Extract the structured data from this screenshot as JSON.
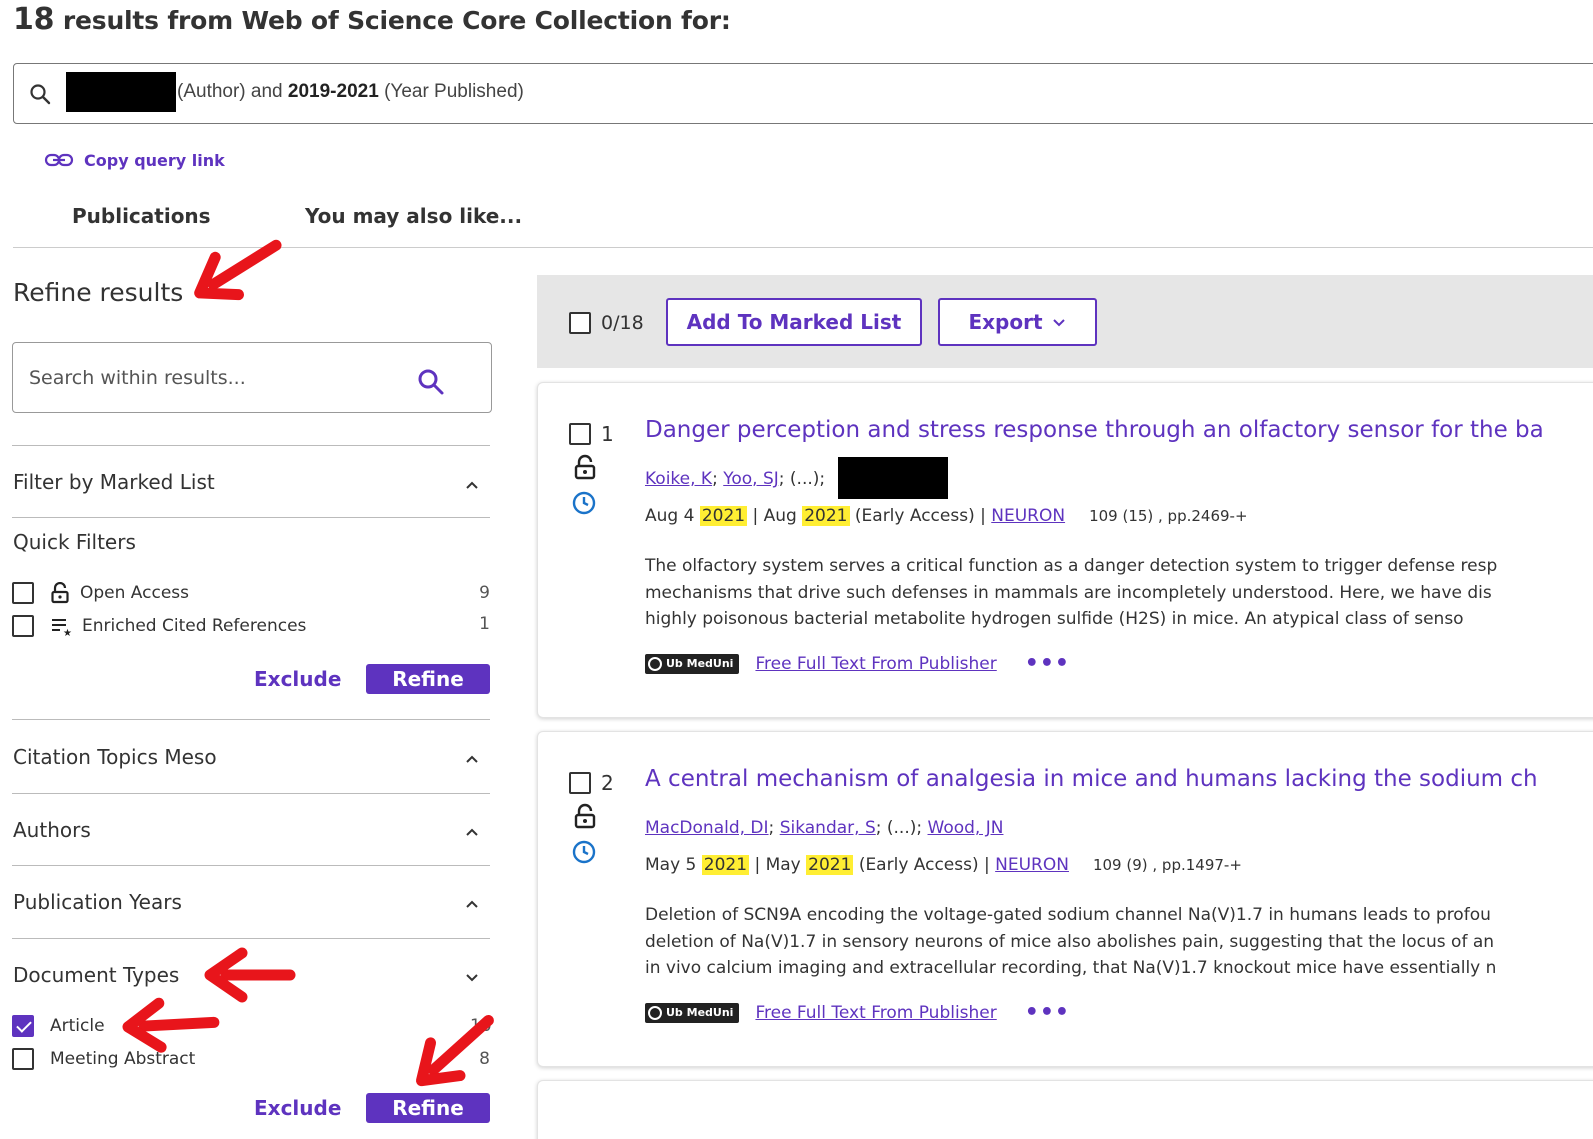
{
  "header": {
    "count": "18",
    "title": "results from Web of Science Core Collection for:",
    "query_field": "(Author) and",
    "query_years": "2019-2021",
    "query_year_field": "(Year Published)",
    "copy_link": "Copy query link"
  },
  "tabs": [
    "Publications",
    "You may also like..."
  ],
  "sidebar": {
    "title": "Refine results",
    "search_placeholder": "Search within results...",
    "sections": {
      "marked_list": "Filter by Marked List",
      "quick_filters": "Quick Filters",
      "citation_topics": "Citation Topics Meso",
      "authors": "Authors",
      "pub_years": "Publication Years",
      "doc_types": "Document Types"
    },
    "quick_filters": [
      {
        "label": "Open Access",
        "count": "9"
      },
      {
        "label": "Enriched Cited References",
        "count": "1"
      }
    ],
    "doc_types": [
      {
        "label": "Article",
        "count": "10",
        "checked": true
      },
      {
        "label": "Meeting Abstract",
        "count": "8",
        "checked": false
      }
    ],
    "exclude_label": "Exclude",
    "refine_label": "Refine"
  },
  "toolbar": {
    "selected": "0/18",
    "add_to_marked": "Add To Marked List",
    "export": "Export"
  },
  "records": [
    {
      "num": "1",
      "title": "Danger perception and stress response through an olfactory sensor for the ba",
      "author1": "Koike, K",
      "author2": "Yoo, SJ",
      "etal": "(...);",
      "date_pre": "Aug 4",
      "year": "2021",
      "date_mid": "| Aug",
      "early": "(Early Access) |",
      "journal": "NEURON",
      "vol": "109 (15) , pp.2469-+",
      "abstract": [
        "The olfactory system serves a critical function as a danger detection system to trigger defense resp",
        "mechanisms that drive such defenses in mammals are incompletely understood. Here, we have dis",
        "highly poisonous bacterial metabolite hydrogen sulfide (H2S) in mice. An atypical class of senso"
      ],
      "badge": "Ub MedUni",
      "fulltext": "Free Full Text From Publisher"
    },
    {
      "num": "2",
      "title": "A central mechanism of analgesia in mice and humans lacking the sodium ch",
      "author1": "MacDonald, DI",
      "author2": "Sikandar, S",
      "etal": "(...);",
      "author3": "Wood, JN",
      "date_pre": "May 5",
      "year": "2021",
      "date_mid": "| May",
      "early": "(Early Access) |",
      "journal": "NEURON",
      "vol": "109 (9) , pp.1497-+",
      "abstract": [
        "Deletion of SCN9A encoding the voltage-gated sodium channel Na(V)1.7 in humans leads to profou",
        "deletion of Na(V)1.7 in sensory neurons of mice also abolishes pain, suggesting that the locus of an",
        "in vivo calcium imaging and extracellular recording, that Na(V)1.7 knockout mice have essentially n"
      ],
      "badge": "Ub MedUni",
      "fulltext": "Free Full Text From Publisher"
    }
  ],
  "colors": {
    "accent": "#5e33bf",
    "highlight": "#ffee33",
    "annotation_arrow": "#e8151b"
  }
}
